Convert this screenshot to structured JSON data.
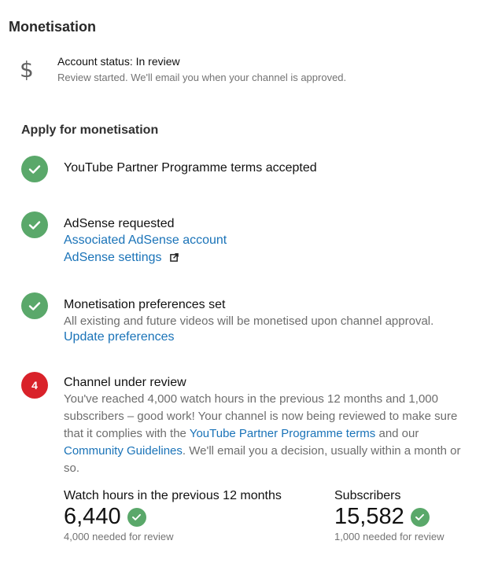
{
  "page": {
    "title": "Monetisation"
  },
  "account": {
    "icon": "dollar-icon",
    "status": "Account status: In review",
    "subtext": "Review started. We'll email you when your channel is approved."
  },
  "apply": {
    "heading": "Apply for monetisation",
    "step1": {
      "title": "YouTube Partner Programme terms accepted",
      "state": "complete"
    },
    "step2": {
      "title": "AdSense requested",
      "state": "complete",
      "link1": "Associated AdSense account",
      "link2": "AdSense settings"
    },
    "step3": {
      "title": "Monetisation preferences set",
      "state": "complete",
      "desc": "All existing and future videos will be monetised upon channel approval.",
      "link": "Update preferences"
    },
    "step4": {
      "number": "4",
      "title": "Channel under review",
      "state": "pending",
      "desc_part1": "You've reached 4,000 watch hours in the previous 12 months and 1,000 subscribers – good work! Your channel is now being reviewed to make sure that it complies with the ",
      "desc_link1": "YouTube Partner Programme terms",
      "desc_part2": " and our ",
      "desc_link2": "Community Guidelines",
      "desc_part3": ". We'll email you a decision, usually within a month or so."
    }
  },
  "stats": {
    "watch_hours": {
      "label": "Watch hours in the previous 12 months",
      "value": "6,440",
      "needed": "4,000 needed for review"
    },
    "subscribers": {
      "label": "Subscribers",
      "value": "15,582",
      "needed": "1,000 needed for review"
    }
  },
  "colors": {
    "check_green": "#5aa86a",
    "pending_red": "#d9222a",
    "link_blue": "#1a73b8"
  }
}
